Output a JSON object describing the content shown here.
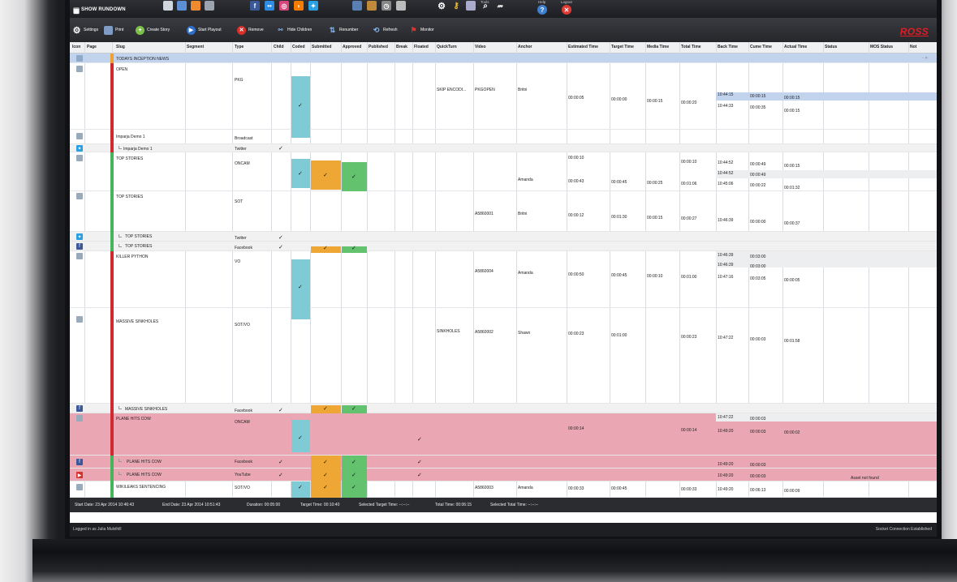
{
  "window_title": "SHOW RUNDOWN",
  "topbar": {
    "tools_caption": "Tools",
    "help_caption": "Help",
    "logout_caption": "Logout"
  },
  "toolbar": {
    "settings": "Settings",
    "print": "Print",
    "create_story": "Create Story",
    "start_playout": "Start Playout",
    "remove": "Remove",
    "hide_children": "Hide Children",
    "renumber": "Renumber",
    "refresh": "Refresh",
    "monitor": "Monitor"
  },
  "brand": "ROSS",
  "columns": {
    "icon": "Icon",
    "page": "Page",
    "slug": "Slug",
    "segment": "Segment",
    "type": "Type",
    "child": "Child",
    "coded": "Coded",
    "submitted": "Submitted",
    "approved": "Approved",
    "published": "Published",
    "break": "Break",
    "floated": "Floated",
    "quickturn": "QuickTurn",
    "video": "Video",
    "anchor": "Anchor",
    "estimated_time": "Estimated Time",
    "target_time": "Target Time",
    "media_time": "Media Time",
    "total_time": "Total Time",
    "back_time": "Back Time",
    "cume_time": "Cume Time",
    "actual_time": "Actual Time",
    "status": "Status",
    "mos_status": "MOS Status",
    "extra": "Not"
  },
  "rows": {
    "r0": {
      "slug": "TODAYS INCEPTION NEWS"
    },
    "r1": {
      "slug": "OPEN",
      "type": "PKG",
      "quickturn": "SKIP ENCODI...",
      "video": "PKGOPEN",
      "anchor": "Britni",
      "est": "00:00:05",
      "target": "00:00:00",
      "media": "00:00:15",
      "total": "00:00:20",
      "back1": "10:44:15",
      "back2": "10:44:33",
      "cume1": "00:00:15",
      "cume2": "00:00:35",
      "actual1": "00:00:15",
      "actual2": "00:00:15"
    },
    "r2": {
      "slug": "Imparja Demo 1",
      "type": "Broadcast"
    },
    "r3": {
      "slug": "Imparja Demo 1",
      "type": "Twitter"
    },
    "r4": {
      "slug": "TOP STORIES",
      "type": "ONCAM",
      "anchor": "Amanda",
      "est1": "00:00:10",
      "est2": "00:00:43",
      "target": "00:00:45",
      "media": "00:00:25",
      "total1": "00:00:10",
      "total2": "00:01:06",
      "back1": "10:44:52",
      "back2": "10:44:52",
      "back3": "10:45:06",
      "cume1": "00:00:49",
      "cume2": "00:00:49",
      "cume3": "00:00:22",
      "actual1": "00:00:15",
      "actual2": "00:01:32"
    },
    "r5": {
      "slug": "TOP STORIES",
      "type": "SOT",
      "video": "A5860001",
      "anchor": "Britni",
      "est": "00:00:12",
      "target": "00:01:30",
      "media": "00:00:15",
      "total": "00:00:27",
      "back": "10:46:39",
      "cume": "00:00:00",
      "actual": "00:00:37"
    },
    "r6": {
      "slug": "TOP STORIES",
      "type": "Twitter"
    },
    "r7": {
      "slug": "TOP STORIES",
      "type": "Facebook"
    },
    "r8": {
      "slug": "KILLER PYTHON",
      "type": "VO",
      "video": "A5860004",
      "anchor": "Amanda",
      "est": "00:00:50",
      "target": "00:00:45",
      "media": "00:00:10",
      "total": "00:01:00",
      "back1": "10:46:39",
      "back2": "10:46:39",
      "back3": "10:47:16",
      "cume1": "00:03:00",
      "cume2": "00:03:00",
      "cume3": "00:03:05",
      "actual": "00:00:05"
    },
    "r9": {
      "slug": "MASSIVE SINKHOLES",
      "type": "SOT/VO",
      "quickturn": "SINKHOLES",
      "video": "A5860002",
      "anchor": "Shawn",
      "est": "00:00:23",
      "target": "00:01:00",
      "total": "00:00:23",
      "back": "10:47:22",
      "cume": "00:00:03",
      "actual": "00:01:58"
    },
    "r10": {
      "slug": "MASSIVE SINKHOLES",
      "type": "Facebook"
    },
    "r11": {
      "slug": "PLANE HITS COW",
      "type": "ONCAM",
      "est": "00:00:14",
      "total": "00:00:14",
      "back1": "10:47:22",
      "back2": "10:49:20",
      "cume1": "00:00:03",
      "cume2": "00:00:03",
      "actual": "00:00:02"
    },
    "r12": {
      "slug": "PLANE HITS COW",
      "type": "Facebook",
      "back": "10:49:20",
      "cume": "00:00:03"
    },
    "r13": {
      "slug": "PLANE HITS COW",
      "type": "YouTube",
      "back": "10:49:20",
      "cume": "00:00:03",
      "mos": "Asset not found"
    },
    "r14": {
      "slug": "WIKILEAKS SENTENCING",
      "type": "SOT/VO",
      "video": "A5860003",
      "anchor": "Amanda",
      "est": "00:00:33",
      "target": "00:00:45",
      "total": "00:00:33",
      "back": "10:49:20",
      "cume": "00:06:13",
      "actual": "00:00:09"
    }
  },
  "status_bar": {
    "start": "Start Date: 23 Apr 2014 10:46:43",
    "end": "End Date: 23 Apr 2014 10:51:43",
    "duration": "Duration: 00:05:00",
    "target": "Target Time: 00:10:40",
    "selected_target": "Selected Target Time: --:--:--",
    "total": "Total Time: 00:06:15",
    "selected_total": "Selected Total Time: --:--:--"
  },
  "footer": {
    "logged_in": "Logged in as Julia Mulvihill",
    "socket": "Socket Connection Established"
  },
  "check": "✓",
  "colors": {
    "coded": "#7ecbd5",
    "submitted": "#eea734",
    "approved": "#62c26e",
    "red_bar": "#d02a31",
    "green_bar": "#45b45a",
    "orange_bar": "#f0a030",
    "pink_row": "#eaa7b3",
    "header_row": "#c2d3ee"
  }
}
